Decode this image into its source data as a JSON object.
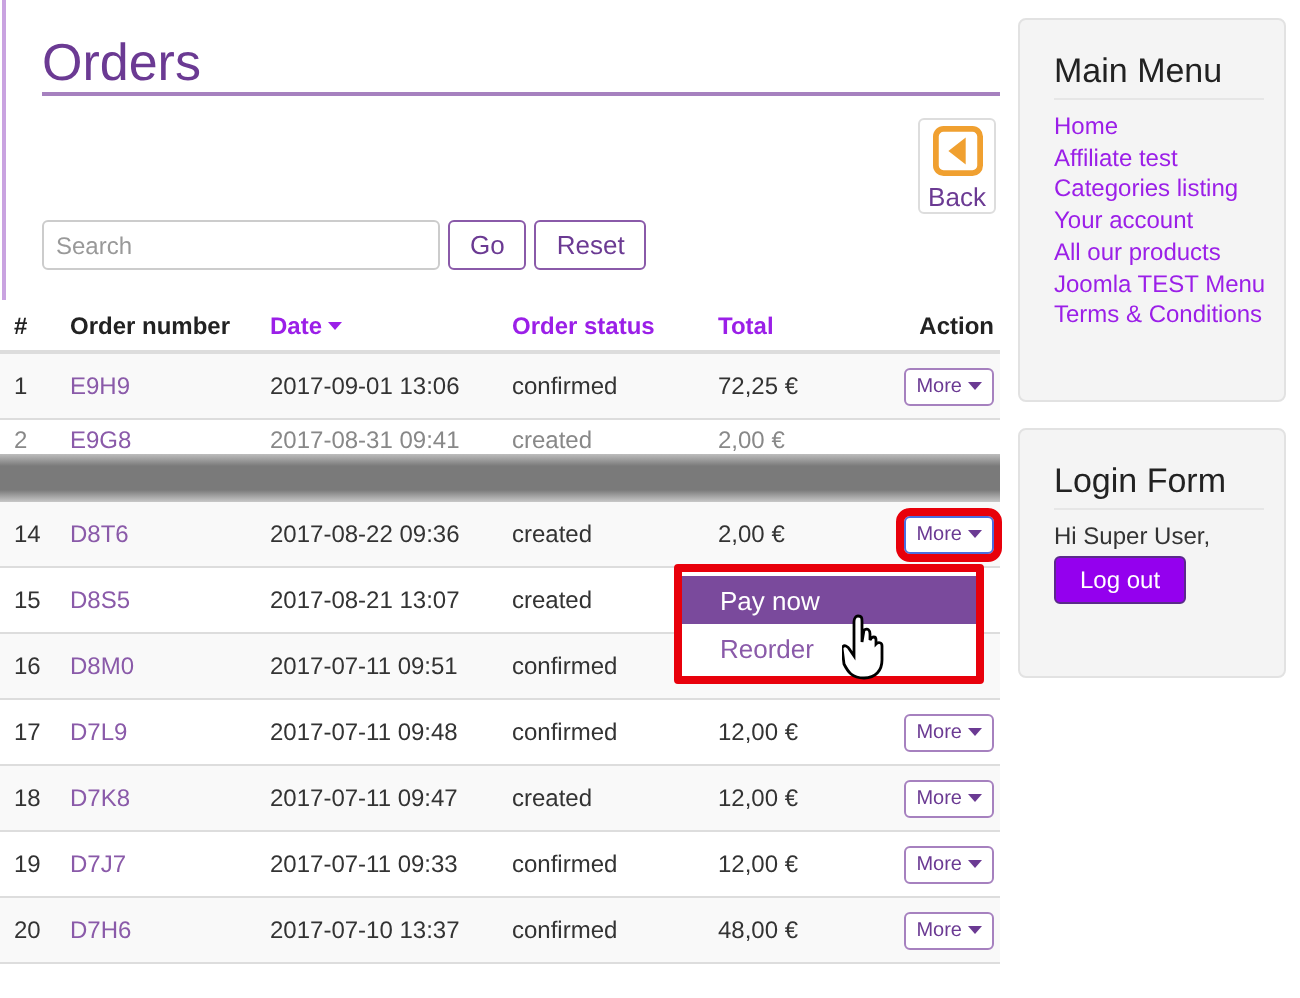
{
  "page": {
    "title": "Orders",
    "back_button": "Back"
  },
  "search": {
    "placeholder": "Search",
    "buttons": [
      "Go",
      "Reset"
    ]
  },
  "table": {
    "columns": [
      {
        "label": "#",
        "sortable": false,
        "sorted": false
      },
      {
        "label": "Order number",
        "sortable": false,
        "sorted": false
      },
      {
        "label": "Date",
        "sortable": true,
        "sorted": true
      },
      {
        "label": "Order status",
        "sortable": true,
        "sorted": false
      },
      {
        "label": "Total",
        "sortable": true,
        "sorted": false
      },
      {
        "label": "Action",
        "sortable": false,
        "sorted": false
      }
    ],
    "rows": [
      {
        "kind": "row",
        "index": "1",
        "order": "E9H9",
        "date": "2017-09-01 13:06",
        "status": "confirmed",
        "total": "72,25 €",
        "action": "More",
        "highlighted": false
      },
      {
        "kind": "cut",
        "index": "2",
        "order": "E9G8",
        "date": "2017-08-31 09:41",
        "status": "created",
        "total": "2,00 €"
      },
      {
        "kind": "row",
        "index": "14",
        "order": "D8T6",
        "date": "2017-08-22 09:36",
        "status": "created",
        "total": "2,00 €",
        "action": "More",
        "highlighted": true
      },
      {
        "kind": "row",
        "index": "15",
        "order": "D8S5",
        "date": "2017-08-21 13:07",
        "status": "created"
      },
      {
        "kind": "row",
        "index": "16",
        "order": "D8M0",
        "date": "2017-07-11 09:51",
        "status": "confirmed"
      },
      {
        "kind": "row",
        "index": "17",
        "order": "D7L9",
        "date": "2017-07-11 09:48",
        "status": "confirmed",
        "total": "12,00 €",
        "action": "More",
        "highlighted": false
      },
      {
        "kind": "row",
        "index": "18",
        "order": "D7K8",
        "date": "2017-07-11 09:47",
        "status": "created",
        "total": "12,00 €",
        "action": "More",
        "highlighted": false
      },
      {
        "kind": "row",
        "index": "19",
        "order": "D7J7",
        "date": "2017-07-11 09:33",
        "status": "confirmed",
        "total": "12,00 €",
        "action": "More",
        "highlighted": false
      },
      {
        "kind": "row",
        "index": "20",
        "order": "D7H6",
        "date": "2017-07-10 13:37",
        "status": "confirmed",
        "total": "48,00 €",
        "action": "More",
        "highlighted": false
      }
    ]
  },
  "dropdown": {
    "items": [
      {
        "label": "Pay now",
        "selected": true
      },
      {
        "label": "Reorder",
        "selected": false
      }
    ]
  },
  "main_menu": {
    "title": "Main Menu",
    "items": [
      "Home",
      "Affiliate test",
      "Categories listing",
      "Your account",
      "All our products",
      "Joomla TEST Menu",
      "Terms & Conditions"
    ]
  },
  "login_form": {
    "title": "Login Form",
    "greeting": "Hi Super User,",
    "button": "Log out"
  }
}
